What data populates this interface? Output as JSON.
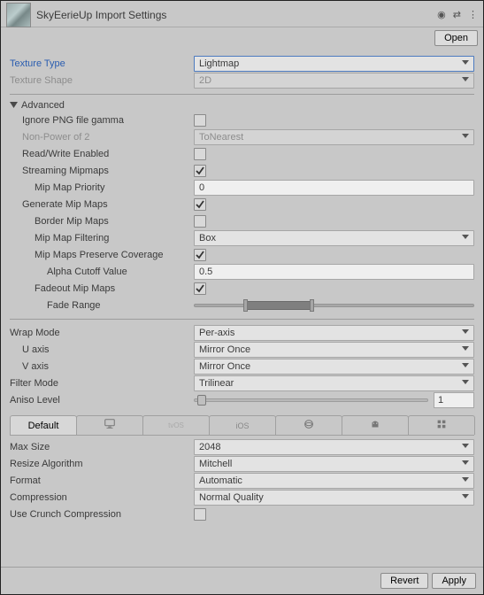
{
  "header": {
    "title": "SkyEerieUp Import Settings",
    "open_btn": "Open"
  },
  "textureType": {
    "label": "Texture Type",
    "value": "Lightmap"
  },
  "textureShape": {
    "label": "Texture Shape",
    "value": "2D"
  },
  "advanced": {
    "title": "Advanced",
    "ignorePngGamma": {
      "label": "Ignore PNG file gamma",
      "checked": false
    },
    "nonPowerOf2": {
      "label": "Non-Power of 2",
      "value": "ToNearest"
    },
    "readWrite": {
      "label": "Read/Write Enabled",
      "checked": false
    },
    "streamingMipmaps": {
      "label": "Streaming Mipmaps",
      "checked": true
    },
    "mipMapPriority": {
      "label": "Mip Map Priority",
      "value": "0"
    },
    "generateMipMaps": {
      "label": "Generate Mip Maps",
      "checked": true
    },
    "borderMipMaps": {
      "label": "Border Mip Maps",
      "checked": false
    },
    "mipMapFiltering": {
      "label": "Mip Map Filtering",
      "value": "Box"
    },
    "mipsPreserveCoverage": {
      "label": "Mip Maps Preserve Coverage",
      "checked": true
    },
    "alphaCutoff": {
      "label": "Alpha Cutoff Value",
      "value": "0.5"
    },
    "fadeoutMipMaps": {
      "label": "Fadeout Mip Maps",
      "checked": true
    },
    "fadeRange": {
      "label": "Fade Range",
      "low_pct": 18,
      "high_pct": 42
    }
  },
  "wrapMode": {
    "label": "Wrap Mode",
    "value": "Per-axis"
  },
  "uAxis": {
    "label": "U axis",
    "value": "Mirror Once"
  },
  "vAxis": {
    "label": "V axis",
    "value": "Mirror Once"
  },
  "filterMode": {
    "label": "Filter Mode",
    "value": "Trilinear"
  },
  "anisoLevel": {
    "label": "Aniso Level",
    "value": "1",
    "pct": 3
  },
  "platformTabs": {
    "default": "Default"
  },
  "maxSize": {
    "label": "Max Size",
    "value": "2048"
  },
  "resizeAlgorithm": {
    "label": "Resize Algorithm",
    "value": "Mitchell"
  },
  "format": {
    "label": "Format",
    "value": "Automatic"
  },
  "compression": {
    "label": "Compression",
    "value": "Normal Quality"
  },
  "useCrunch": {
    "label": "Use Crunch Compression",
    "checked": false
  },
  "footer": {
    "revert": "Revert",
    "apply": "Apply"
  }
}
